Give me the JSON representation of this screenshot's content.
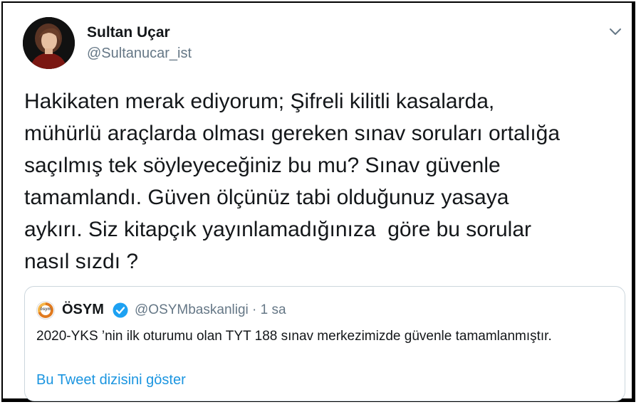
{
  "author": {
    "name": "Sultan Uçar",
    "handle": "@Sultanucar_ist"
  },
  "tweet": {
    "text": "Hakikaten merak ediyorum; Şifreli kilitli kasalarda,\nmühürlü araçlarda olması gereken sınav soruları ortalığa\nsaçılmış tek söyleyeceğiniz bu mu? Sınav güvenle\ntamamlandı. Güven ölçünüz tabi olduğunuz yasaya\naykırı. Siz kitapçık yayınlamadığınıza  göre bu sorular\nnasıl sızdı ?"
  },
  "quoted": {
    "logo_text": "ösym",
    "name": "ÖSYM",
    "handle_time": "@OSYMbaskanligi · 1 sa",
    "text": "2020-YKS ’nin ilk oturumu olan TYT 188 sınav merkezimizde güvenle tamamlanmıştır.",
    "show_thread": "Bu Tweet dizisini göster"
  },
  "colors": {
    "link": "#1b95e0",
    "secondary": "#657786",
    "verified": "#1da1f2"
  },
  "icons": {
    "menu": "chevron-down-icon",
    "verified": "verified-badge-icon"
  }
}
